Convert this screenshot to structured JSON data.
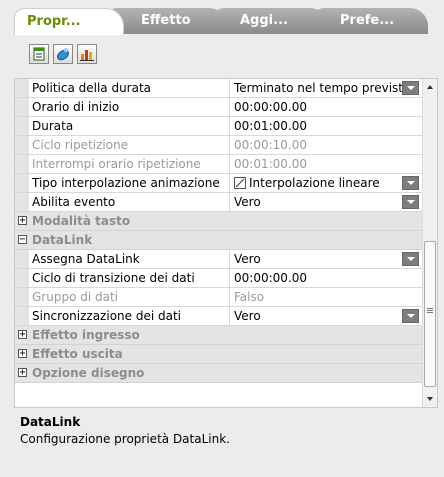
{
  "tabs": [
    {
      "label": "Propr...",
      "active": true
    },
    {
      "label": "Effetto",
      "active": false
    },
    {
      "label": "Aggi...",
      "active": false
    },
    {
      "label": "Prefe...",
      "active": false
    }
  ],
  "toolbar": {
    "buttons": [
      {
        "name": "categorized-view-icon"
      },
      {
        "name": "paint-bucket-icon"
      },
      {
        "name": "bar-chart-icon"
      }
    ]
  },
  "properties": [
    {
      "type": "row",
      "name": "Politica della durata",
      "value": "Terminato nel tempo previsto",
      "dropdown": true,
      "disabled": false
    },
    {
      "type": "row",
      "name": "Orario di inizio",
      "value": "00:00:00.00",
      "dropdown": false,
      "disabled": false
    },
    {
      "type": "row",
      "name": "Durata",
      "value": "00:01:00.00",
      "dropdown": false,
      "disabled": false
    },
    {
      "type": "row",
      "name": "Ciclo ripetizione",
      "value": "00:00:10.00",
      "dropdown": false,
      "disabled": true
    },
    {
      "type": "row",
      "name": "Interrompi orario ripetizione",
      "value": "00:01:00.00",
      "dropdown": false,
      "disabled": true
    },
    {
      "type": "row",
      "name": "Tipo interpolazione animazione",
      "value": "Interpolazione lineare",
      "dropdown": true,
      "disabled": false,
      "valueIcon": "interpolation-icon"
    },
    {
      "type": "row",
      "name": "Abilita evento",
      "value": "Vero",
      "dropdown": true,
      "disabled": false
    },
    {
      "type": "category",
      "name": "Modalità tasto",
      "expanded": false
    },
    {
      "type": "category",
      "name": "DataLink",
      "expanded": true
    },
    {
      "type": "row",
      "name": "Assegna DataLink",
      "value": "Vero",
      "dropdown": true,
      "disabled": false
    },
    {
      "type": "row",
      "name": "Ciclo di transizione dei dati",
      "value": "00:00:00.00",
      "dropdown": false,
      "disabled": false
    },
    {
      "type": "row",
      "name": "Gruppo di dati",
      "value": "Falso",
      "dropdown": false,
      "disabled": true
    },
    {
      "type": "row",
      "name": "Sincronizzazione dei dati",
      "value": "Vero",
      "dropdown": true,
      "disabled": false
    },
    {
      "type": "category",
      "name": "Effetto ingresso",
      "expanded": false
    },
    {
      "type": "category",
      "name": "Effetto uscita",
      "expanded": false
    },
    {
      "type": "category",
      "name": "Opzione disegno",
      "expanded": false
    }
  ],
  "description": {
    "title": "DataLink",
    "text": "Configurazione proprietà DataLink."
  },
  "colors": {
    "active_tab_text": "#6a8e00",
    "category_text": "#8c8c8c",
    "disabled_text": "#9a9a9a",
    "dropdown_button": "#7d7d7d"
  }
}
